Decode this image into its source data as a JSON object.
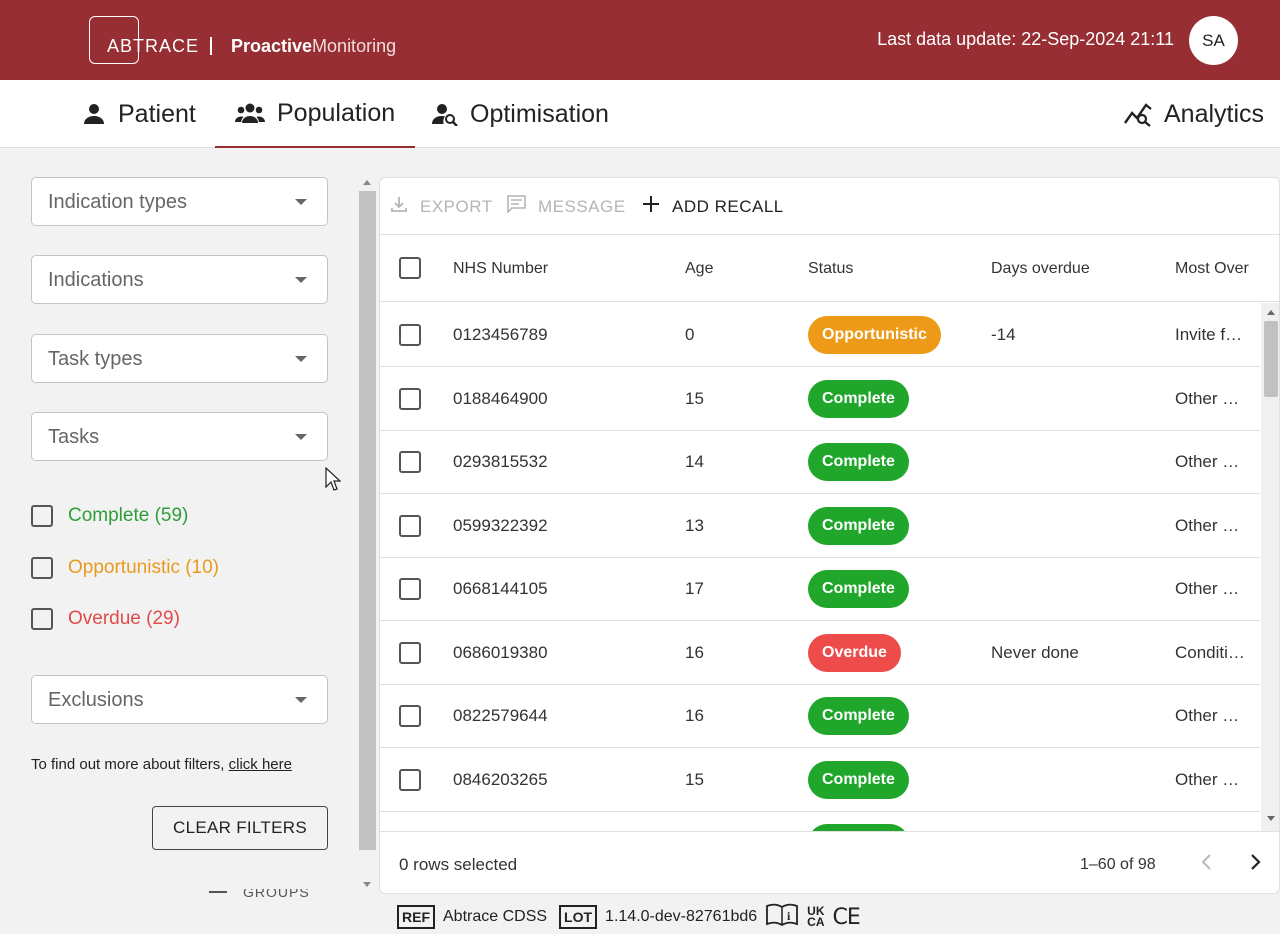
{
  "header": {
    "logo_text": "ABTRACE",
    "app_name_bold": "Proactive",
    "app_name_light": "Monitoring",
    "last_update": "Last data update: 22-Sep-2024 21:11",
    "avatar_initials": "SA"
  },
  "nav": {
    "tabs": [
      {
        "label": "Patient",
        "icon": "person-icon"
      },
      {
        "label": "Population",
        "icon": "group-icon",
        "active": true
      },
      {
        "label": "Optimisation",
        "icon": "person-search-icon"
      }
    ],
    "analytics": {
      "label": "Analytics",
      "icon": "analytics-icon"
    }
  },
  "filters": {
    "selects": [
      "Indication types",
      "Indications",
      "Task types",
      "Tasks"
    ],
    "status_checks": [
      {
        "label": "Complete (59)",
        "color": "#2e9e39"
      },
      {
        "label": "Opportunistic (10)",
        "color": "#e99a1d"
      },
      {
        "label": "Overdue (29)",
        "color": "#e34a4a"
      }
    ],
    "exclusions": "Exclusions",
    "info_text": "To find out more about filters, ",
    "info_link": "click here",
    "clear_label": "CLEAR FILTERS",
    "groups_peek": "GROUPS"
  },
  "toolbar": {
    "export": "EXPORT",
    "message": "MESSAGE",
    "add_recall": "ADD RECALL"
  },
  "table": {
    "columns": [
      "NHS Number",
      "Age",
      "Status",
      "Days overdue",
      "Most Over"
    ],
    "rows": [
      {
        "nhs": "0123456789",
        "age": "0",
        "status": "Opportunistic",
        "days": "-14",
        "most": "Invite f…"
      },
      {
        "nhs": "0188464900",
        "age": "15",
        "status": "Complete",
        "days": "",
        "most": "Other …"
      },
      {
        "nhs": "0293815532",
        "age": "14",
        "status": "Complete",
        "days": "",
        "most": "Other …"
      },
      {
        "nhs": "0599322392",
        "age": "13",
        "status": "Complete",
        "days": "",
        "most": "Other …"
      },
      {
        "nhs": "0668144105",
        "age": "17",
        "status": "Complete",
        "days": "",
        "most": "Other …"
      },
      {
        "nhs": "0686019380",
        "age": "16",
        "status": "Overdue",
        "days": "Never done",
        "most": "Conditi…"
      },
      {
        "nhs": "0822579644",
        "age": "16",
        "status": "Complete",
        "days": "",
        "most": "Other …"
      },
      {
        "nhs": "0846203265",
        "age": "15",
        "status": "Complete",
        "days": "",
        "most": "Other …"
      },
      {
        "nhs": "",
        "age": "",
        "status": "Complete",
        "days": "",
        "most": ""
      }
    ],
    "rows_selected": "0 rows selected",
    "pagination": "1–60 of 98"
  },
  "regulatory": {
    "ref_label": "REF",
    "product": "Abtrace CDSS",
    "lot_label": "LOT",
    "version": "1.14.0-dev-82761bd6",
    "ukca": "UK CA",
    "ce": "CE"
  },
  "colors": {
    "brand": "#962e33",
    "complete": "#1fa62b",
    "opportunistic": "#ec9a17",
    "overdue": "#ee4b4b"
  }
}
